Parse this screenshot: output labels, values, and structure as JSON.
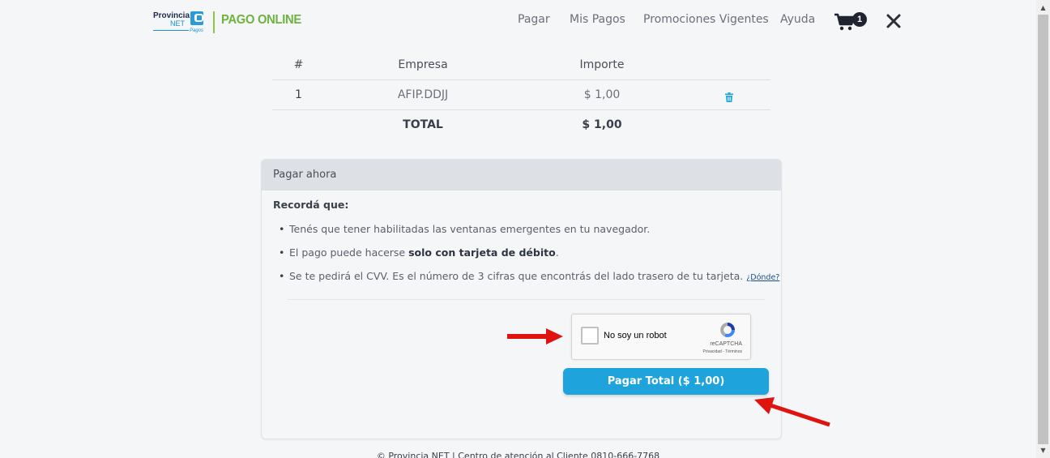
{
  "header": {
    "logo": {
      "line1": "Provincia",
      "line2": "NET",
      "line3": "Pagos"
    },
    "brand": "PAGO ONLINE",
    "nav": [
      "Pagar",
      "Mis Pagos",
      "Promociones Vigentes",
      "Ayuda"
    ],
    "cart_count": "1",
    "icons": {
      "cart": "shopping-cart-icon",
      "close": "close-icon"
    }
  },
  "table": {
    "headers": [
      "#",
      "Empresa",
      "Importe"
    ],
    "rows": [
      {
        "num": "1",
        "empresa": "AFIP.DDJJ",
        "importe": "$ 1,00",
        "action_icon": "trash-icon"
      }
    ],
    "total_label": "TOTAL",
    "total_value": "$ 1,00"
  },
  "panel": {
    "title": "Pagar ahora",
    "reminder": "Recordá que:",
    "bullets": [
      {
        "text": "Tenés que tener habilitadas las ventanas emergentes en tu navegador."
      },
      {
        "before": "El pago puede hacerse ",
        "bold": "solo con tarjeta de débito",
        "after": "."
      },
      {
        "text": "Se te pedirá el CVV. Es el número de 3 cifras que encontrás del lado trasero de tu tarjeta.",
        "link": "¿Dónde?"
      }
    ],
    "captcha": {
      "label": "No soy un robot",
      "brand": "reCAPTCHA",
      "links": "Privacidad - Términos"
    },
    "pay_button": "Pagar Total ($ 1,00)"
  },
  "footer": "© Provincia NET | Centro de atención al Cliente 0810-666-7768",
  "colors": {
    "accent": "#1fa3dc",
    "brand_green": "#6cb33f",
    "annotation_arrow": "#e0140f"
  }
}
